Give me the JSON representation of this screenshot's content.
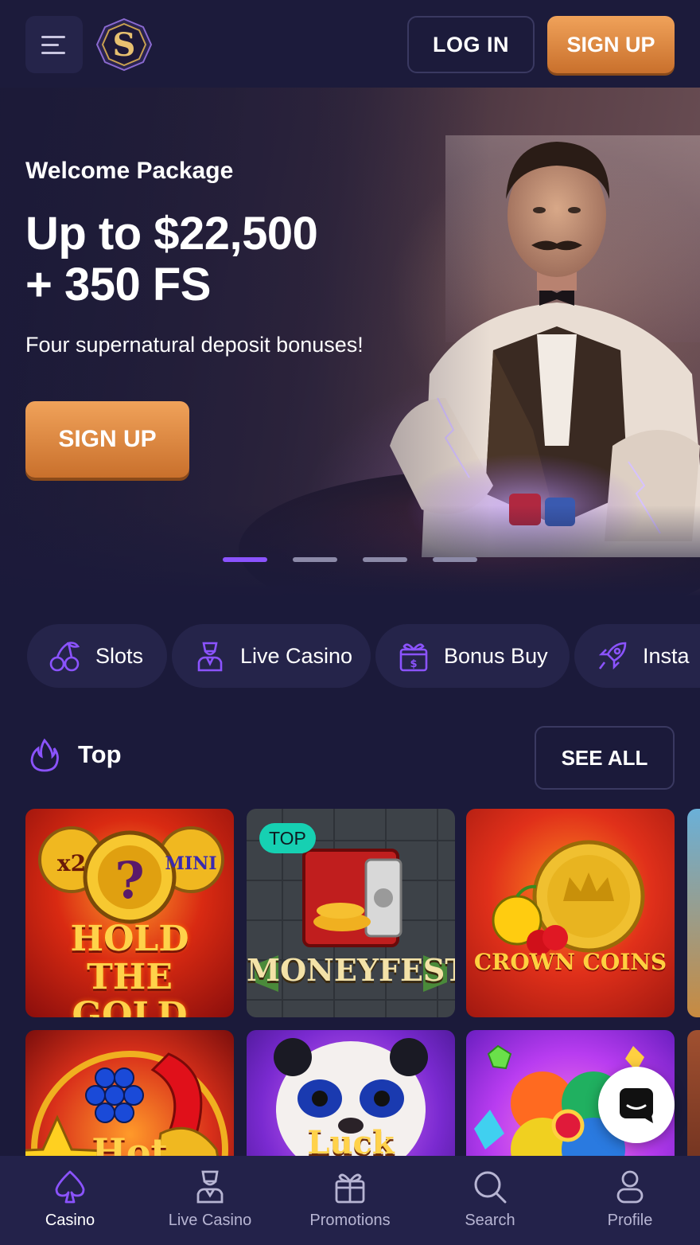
{
  "header": {
    "login_label": "LOG IN",
    "signup_label": "SIGN UP"
  },
  "hero": {
    "kicker": "Welcome Package",
    "title_line1": "Up to $22,500",
    "title_line2": "+ 350 FS",
    "subtitle": "Four supernatural deposit bonuses!",
    "cta_label": "SIGN UP",
    "slides_count": 4,
    "active_slide": 1
  },
  "categories": [
    {
      "label": "Slots",
      "icon": "cherries-icon"
    },
    {
      "label": "Live Casino",
      "icon": "dealer-icon"
    },
    {
      "label": "Bonus Buy",
      "icon": "gift-dollar-icon"
    },
    {
      "label": "Instant",
      "icon": "rocket-icon",
      "visible_text": "Insta"
    }
  ],
  "section": {
    "title": "Top",
    "see_all_label": "SEE ALL"
  },
  "games": [
    {
      "title": "HOLD THE GOLD",
      "badges": [
        "x2",
        "MINI"
      ]
    },
    {
      "title": "MONEYFEST",
      "tag": "TOP"
    },
    {
      "title": "CROWN COINS"
    },
    {
      "title": ""
    },
    {
      "title": "Hot"
    },
    {
      "title": "Luck"
    },
    {
      "title": ""
    },
    {
      "title": ""
    }
  ],
  "bottom_nav": [
    {
      "label": "Casino",
      "icon": "spade-icon",
      "active": true
    },
    {
      "label": "Live Casino",
      "icon": "dealer-icon",
      "active": false
    },
    {
      "label": "Promotions",
      "icon": "gift-icon",
      "active": false
    },
    {
      "label": "Search",
      "icon": "search-icon",
      "active": false
    },
    {
      "label": "Profile",
      "icon": "user-icon",
      "active": false
    }
  ],
  "colors": {
    "background": "#1b1a3a",
    "accent_orange": "#e08a40",
    "accent_purple": "#8b53ff",
    "tag_teal": "#16d0b2"
  }
}
